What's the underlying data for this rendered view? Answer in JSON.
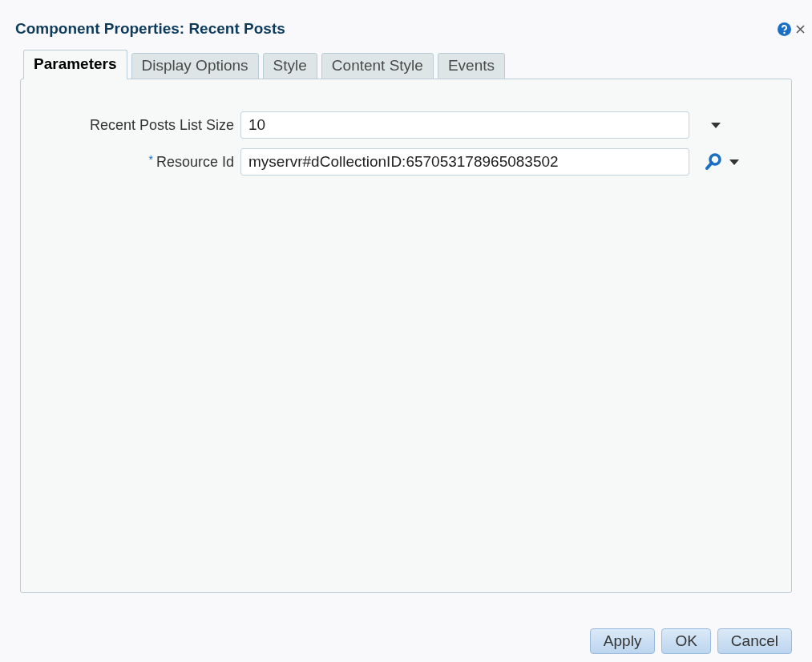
{
  "window": {
    "title": "Component Properties: Recent Posts"
  },
  "tabs": [
    {
      "label": "Parameters",
      "selected": true
    },
    {
      "label": "Display Options",
      "selected": false
    },
    {
      "label": "Style",
      "selected": false
    },
    {
      "label": "Content Style",
      "selected": false
    },
    {
      "label": "Events",
      "selected": false
    }
  ],
  "fields": [
    {
      "label": "Recent Posts List Size",
      "value": "10",
      "kind": "dropdown"
    },
    {
      "label": "Resource Id",
      "required_mark": "*",
      "value": "myservr#dCollectionID:657053178965083502",
      "kind": "search"
    }
  ],
  "buttons": [
    "Apply",
    "OK",
    "Cancel"
  ]
}
